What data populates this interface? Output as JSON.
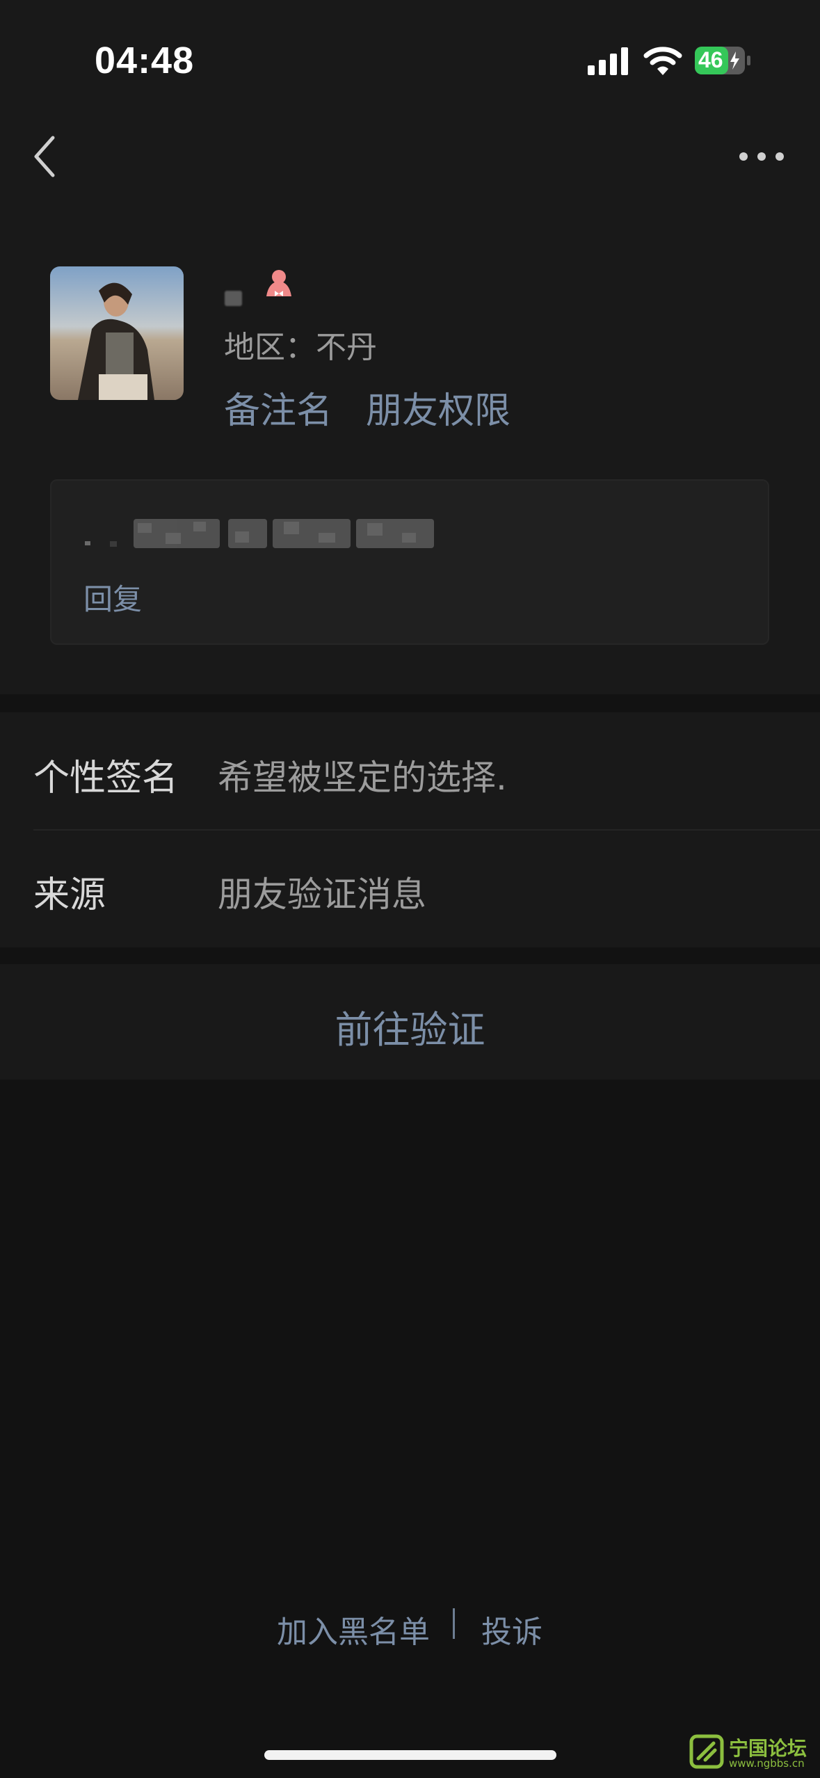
{
  "status_bar": {
    "time": "04:48",
    "battery_level": "46"
  },
  "profile": {
    "region_label": "地区：",
    "region_value": "不丹",
    "remark_link": "备注名",
    "permission_link": "朋友权限"
  },
  "message_card": {
    "reply_label": "回复"
  },
  "info_rows": [
    {
      "label": "个性签名",
      "value": "希望被坚定的选择."
    },
    {
      "label": "来源",
      "value": "朋友验证消息"
    }
  ],
  "verify_button": "前往验证",
  "footer": {
    "blacklist": "加入黑名单",
    "report": "投诉"
  },
  "watermark": {
    "title": "宁国论坛",
    "url": "www.ngbbs.cn"
  },
  "colors": {
    "link": "#7c8fa8",
    "background": "#121212",
    "section": "#191919",
    "battery_fill": "#35c759"
  }
}
